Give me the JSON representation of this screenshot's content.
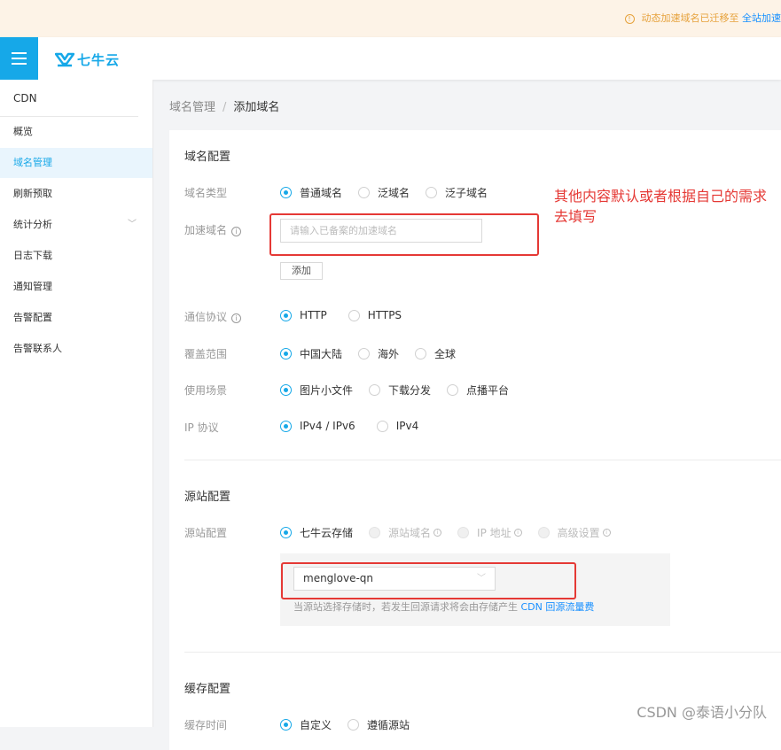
{
  "notice": {
    "text": "动态加速域名已迁移至",
    "link": "全站加速"
  },
  "brand": {
    "logo_text": "七牛云"
  },
  "sidebar": {
    "title": "CDN",
    "items": [
      {
        "label": "概览"
      },
      {
        "label": "域名管理"
      },
      {
        "label": "刷新预取"
      },
      {
        "label": "统计分析"
      },
      {
        "label": "日志下载"
      },
      {
        "label": "通知管理"
      },
      {
        "label": "告警配置"
      },
      {
        "label": "告警联系人"
      }
    ]
  },
  "breadcrumb": {
    "parent": "域名管理",
    "current": "添加域名"
  },
  "domain_config": {
    "title": "域名配置",
    "type_label": "域名类型",
    "type_options": [
      "普通域名",
      "泛域名",
      "泛子域名"
    ],
    "accel_label": "加速域名",
    "accel_placeholder": "请输入已备案的加速域名",
    "add_button": "添加",
    "protocol_label": "通信协议",
    "protocol_options": [
      "HTTP",
      "HTTPS"
    ],
    "coverage_label": "覆盖范围",
    "coverage_options": [
      "中国大陆",
      "海外",
      "全球"
    ],
    "scenario_label": "使用场景",
    "scenario_options": [
      "图片小文件",
      "下载分发",
      "点播平台"
    ],
    "ip_label": "IP 协议",
    "ip_options": [
      "IPv4 / IPv6",
      "IPv4"
    ]
  },
  "origin_config": {
    "title": "源站配置",
    "label": "源站配置",
    "options": [
      "七牛云存储",
      "源站域名",
      "IP 地址",
      "高级设置"
    ],
    "bucket": "menglove-qn",
    "hint_text": "当源站选择存储时，若发生回源请求将会由存储产生",
    "hint_link": "CDN 回源流量费"
  },
  "cache_config": {
    "title": "缓存配置",
    "label": "缓存时间",
    "options": [
      "自定义",
      "遵循源站"
    ]
  },
  "annotation": "其他内容默认或者根据自己的需求去填写",
  "watermark": "CSDN @泰语小分队",
  "colors": {
    "accent": "#16a8e8",
    "annotation_red": "#e53935"
  }
}
